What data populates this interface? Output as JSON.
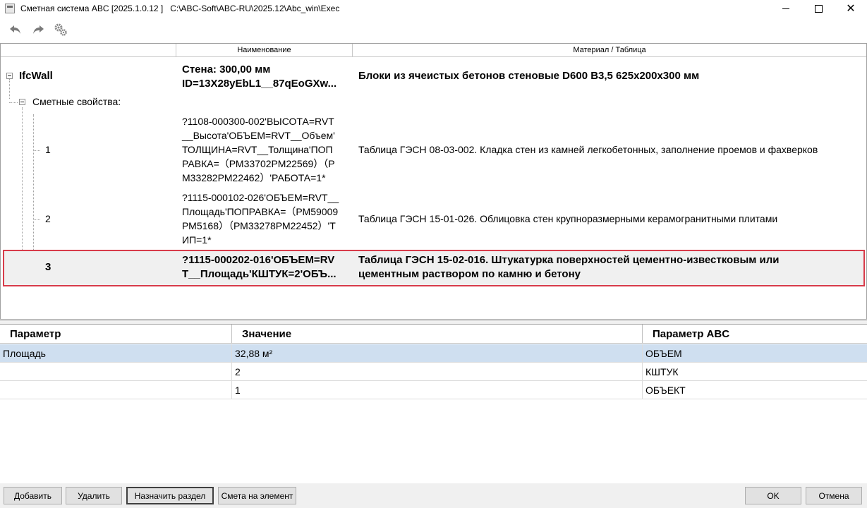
{
  "window": {
    "title": "Сметная система ABC [2025.1.0.12 ]   C:\\ABC-Soft\\ABC-RU\\2025.12\\Abc_win\\Exec",
    "minimize": "",
    "maximize": "",
    "close": "✕"
  },
  "toolbar": {
    "undo_icon": "undo-icon",
    "redo_icon": "redo-icon",
    "settings_icon": "gears-icon"
  },
  "tree": {
    "columns": [
      "",
      "Наименование",
      "Материал / Таблица"
    ],
    "root": {
      "label": "IfcWall",
      "name_line1": "Стена: 300,00 мм",
      "name_line2": "ID=13X28yEbL1__87qEoGXw...",
      "material": "Блоки из ячеистых бетонов стеновые D600 B3,5 625х200х300 мм"
    },
    "group": {
      "label": "Сметные свойства:"
    },
    "items": [
      {
        "num": "1",
        "code_lines": [
          "?1108-000300-002'ВЫСОТА=RVT",
          "__Высота'ОБЪЕМ=RVT__Объем'",
          "ТОЛЩИНА=RVT__Толщина'ПОП",
          "РАВКА=（РМ33702РМ22569）（Р",
          "М33282РМ22462）'РАБОТА=1*"
        ],
        "table": "Таблица ГЭСН 08-03-002. Кладка стен из камней легкобетонных, заполнение проемов и фахверков"
      },
      {
        "num": "2",
        "code_lines": [
          "?1115-000102-026'ОБЪЕМ=RVT__",
          "Площадь'ПОПРАВКА=（РМ59009",
          "РМ5168）（РМ33278РМ22452）'Т",
          "ИП=1*"
        ],
        "table": "Таблица ГЭСН 15-01-026. Облицовка стен крупноразмерными керамогранитными плитами"
      },
      {
        "num": "3",
        "code_lines": [
          "?1115-000202-016'ОБЪЕМ=RV",
          "T__Площадь'КШТУК=2'ОБЪ..."
        ],
        "table_lines": [
          "Таблица ГЭСН 15-02-016. Штукатурка поверхностей цементно-известковым или",
          "цементным раствором по камню и бетону"
        ]
      }
    ]
  },
  "grid": {
    "headers": [
      "Параметр",
      "Значение",
      "Параметр ABC"
    ],
    "rows": [
      [
        "Площадь",
        "32,88  м²",
        "ОБЪЕМ"
      ],
      [
        "",
        "2",
        "КШТУК"
      ],
      [
        "",
        "1",
        "ОБЪЕКТ"
      ]
    ]
  },
  "buttons": {
    "add": "Добавить",
    "delete": "Удалить",
    "assign_section": "Назначить раздел",
    "estimate_element": "Смета на элемент",
    "ok": "OK",
    "cancel": "Отмена"
  }
}
